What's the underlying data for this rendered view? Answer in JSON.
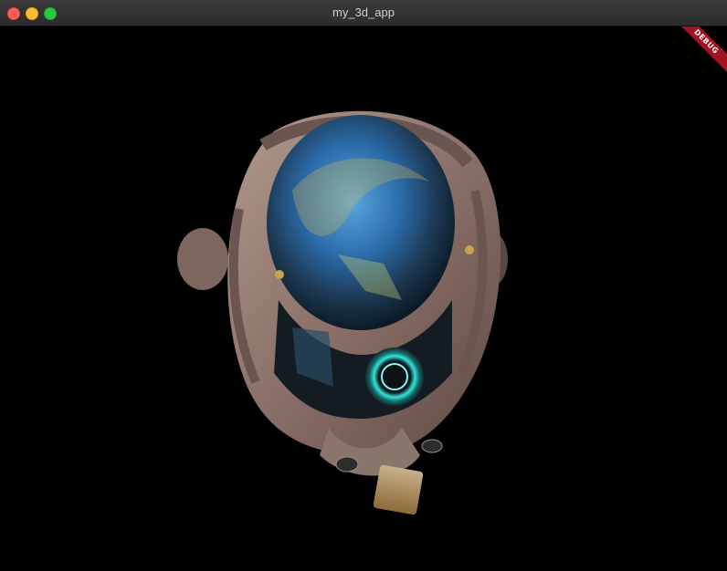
{
  "window": {
    "title": "my_3d_app"
  },
  "debug_banner": {
    "label": "DEBUG"
  },
  "scene": {
    "model": "helmet-3d-model",
    "background_color": "#000000"
  }
}
